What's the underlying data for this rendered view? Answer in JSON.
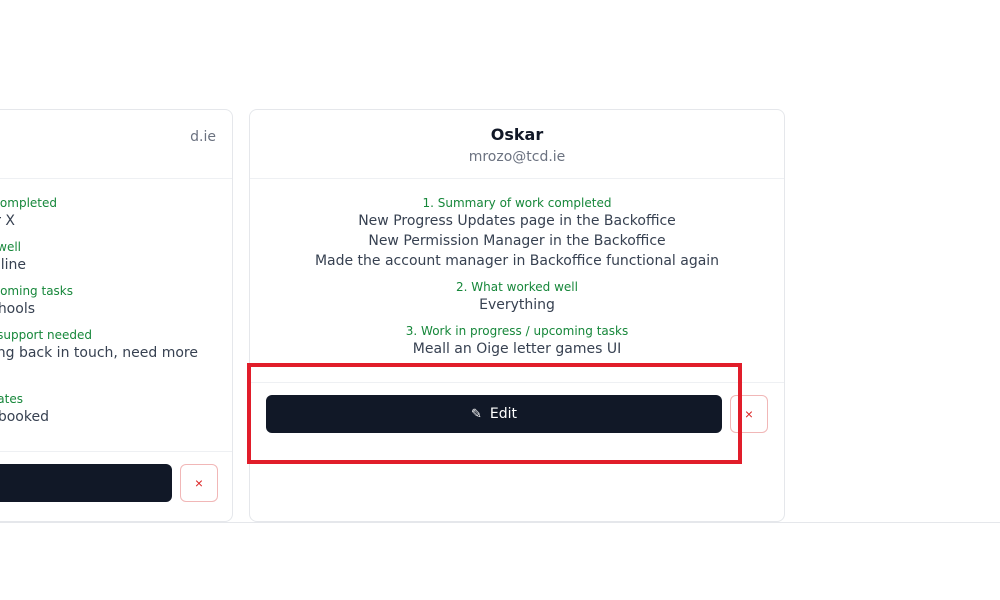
{
  "cards": [
    {
      "name": "",
      "email": "d.ie",
      "sections": [
        {
          "title": "completed",
          "lines": [
            "r X"
          ]
        },
        {
          "title": "well",
          "lines": [
            "dline"
          ]
        },
        {
          "title": "coming tasks",
          "lines": [
            "hools"
          ]
        },
        {
          "title": "support needed",
          "lines": [
            "tting back in touch, need more",
            ""
          ]
        },
        {
          "title": "ates",
          "lines": [
            "booked"
          ]
        }
      ],
      "edit_label": "",
      "delete_label": "×"
    },
    {
      "name": "Oskar",
      "email": "mrozo@tcd.ie",
      "sections": [
        {
          "title": "1. Summary of work completed",
          "lines": [
            "New Progress Updates page in the Backoffice",
            "New Permission Manager in the Backoffice",
            "Made the account manager in Backoffice functional again"
          ]
        },
        {
          "title": "2. What worked well",
          "lines": [
            "Everything"
          ]
        },
        {
          "title": "3. Work in progress / upcoming tasks",
          "lines": [
            "Meall an Oige letter games UI"
          ]
        }
      ],
      "edit_icon": "pencil-icon",
      "edit_label": "Edit",
      "delete_label": "×"
    }
  ],
  "colors": {
    "button_dark": "#111827",
    "section_title": "#16873a",
    "delete": "#dc2626",
    "highlight": "#e11d2a"
  }
}
